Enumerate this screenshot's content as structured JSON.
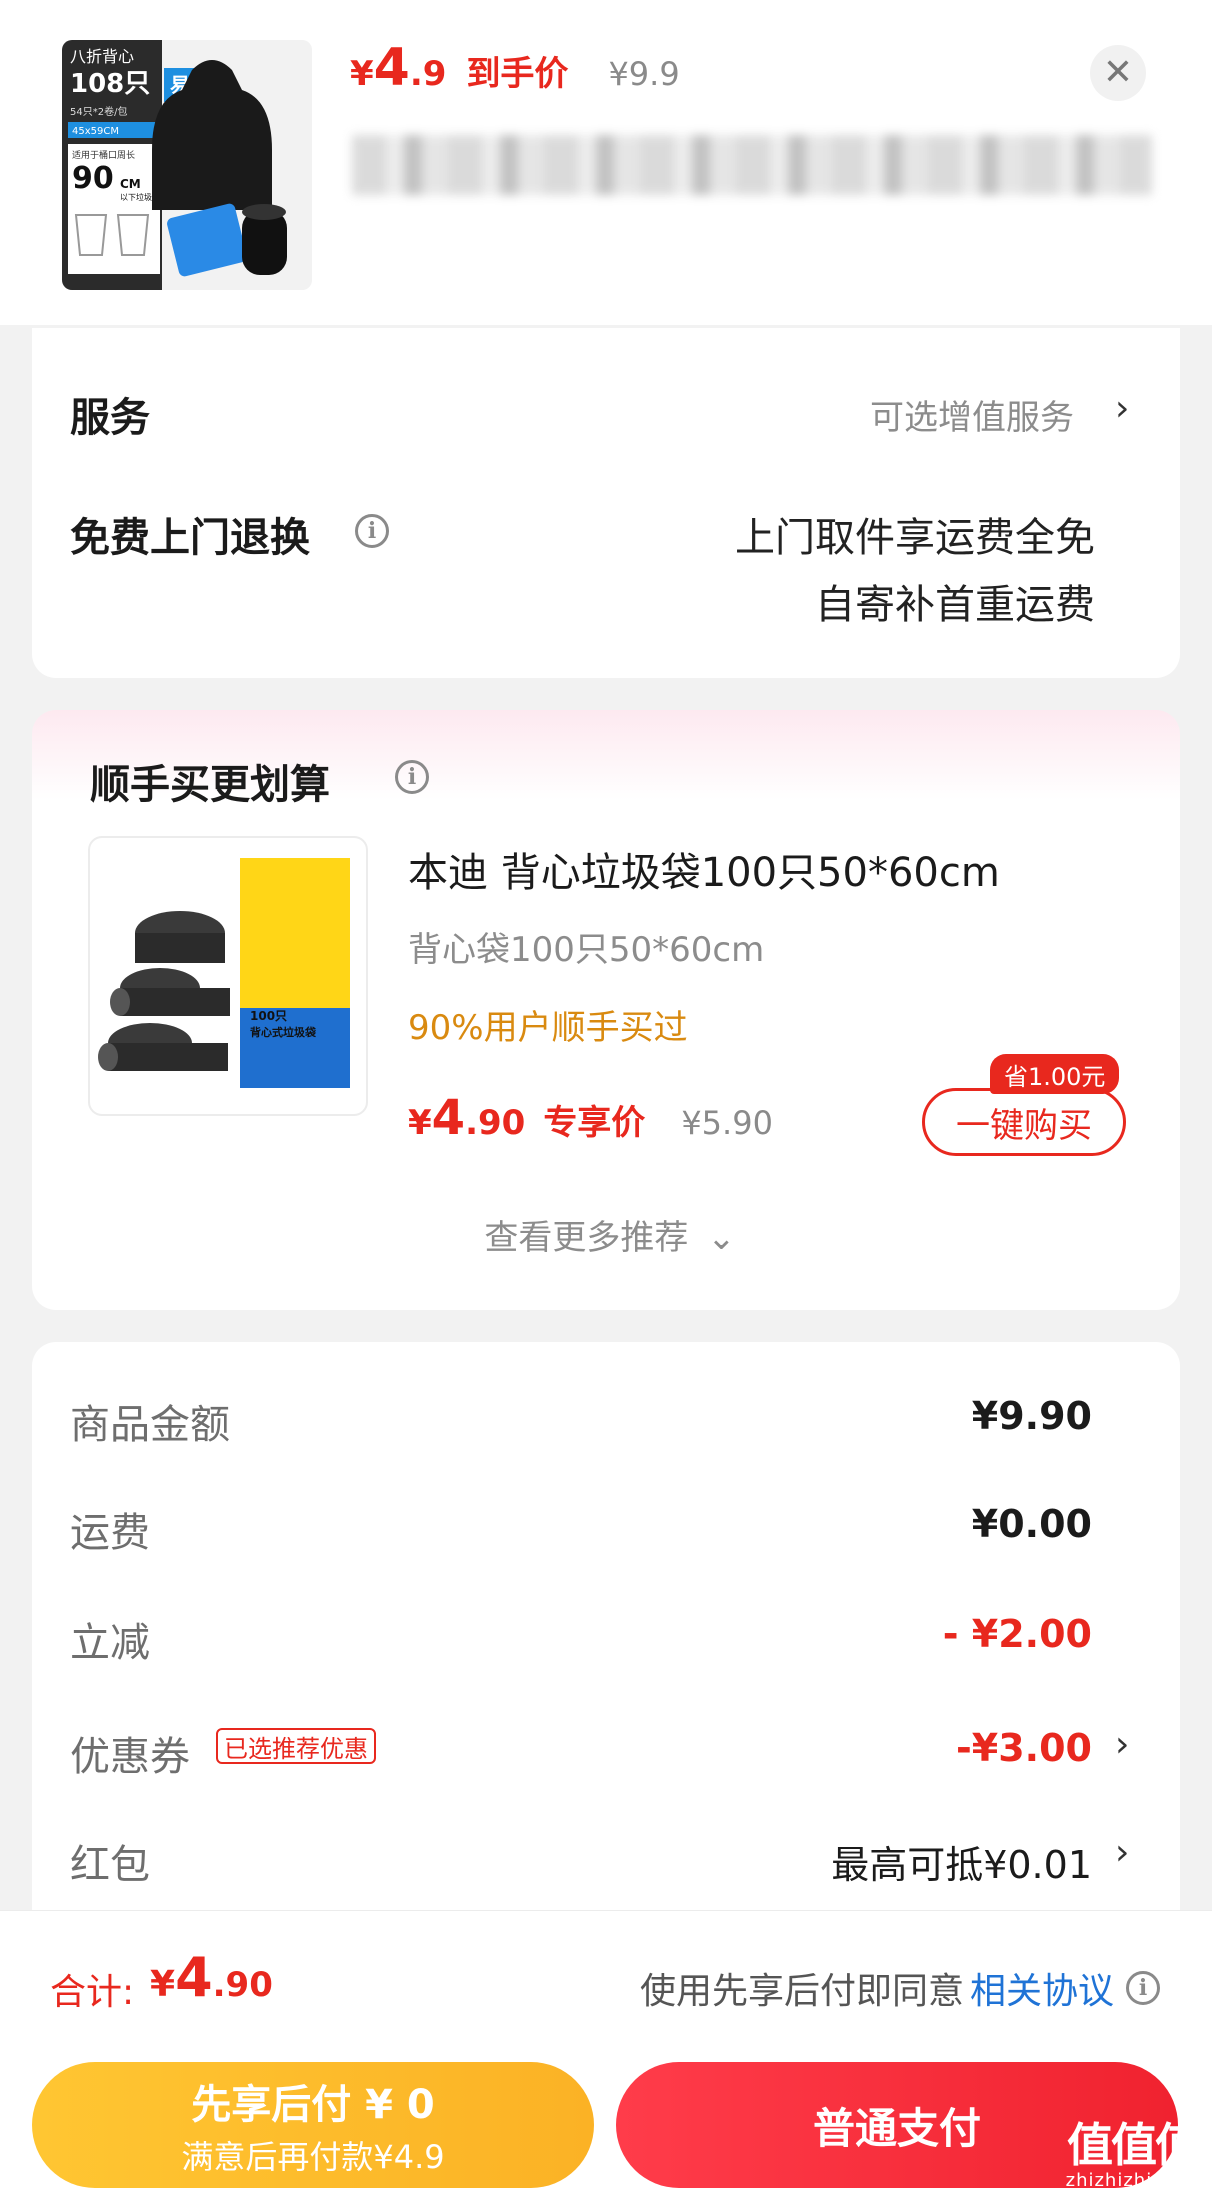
{
  "product": {
    "price_symbol": "¥",
    "price_int": "4",
    "price_dec": ".9",
    "price_tag": "到手价",
    "original_price": "¥9.9",
    "close_icon": "close-icon",
    "thumb_texts": {
      "badge_top": "八折背心",
      "badge_count": "108只",
      "badge_easy": "易撕",
      "spec_line": "54只*2卷/包",
      "size_line": "45x59CM",
      "fit_line": "适用于桶口周长",
      "fit_value": "90",
      "fit_unit": "CM",
      "fit_note": "以下垃圾桶"
    }
  },
  "services": {
    "title": "服务",
    "optional_label": "可选增值服务",
    "return_title": "免费上门退换",
    "return_line1": "上门取件享运费全免",
    "return_line2": "自寄补首重运费"
  },
  "recommend": {
    "title": "顺手买更划算",
    "item_name": "本迪 背心垃圾袋100只50*60cm",
    "item_spec": "背心袋100只50*60cm",
    "item_social": "90%用户顺手买过",
    "price_symbol": "¥",
    "price_int": "4",
    "price_dec": ".90",
    "price_tag": "专享价",
    "original_price": "¥5.90",
    "save_badge": "省1.00元",
    "buy_button": "一键购买",
    "more_label": "查看更多推荐",
    "pack_count": "100只",
    "pack_label": "背心式垃圾袋"
  },
  "summary": {
    "rows": [
      {
        "label": "商品金额",
        "value": "¥9.90"
      },
      {
        "label": "运费",
        "value": "¥0.00"
      },
      {
        "label": "立减",
        "value": "- ¥2.00"
      },
      {
        "label": "优惠券",
        "value": "-¥3.00",
        "tag": "已选推荐优惠"
      },
      {
        "label": "红包",
        "value": "最高可抵¥0.01"
      }
    ]
  },
  "footer": {
    "total_label": "合计:",
    "total_symbol": "¥",
    "total_int": "4",
    "total_dec": ".90",
    "agree_text": "使用先享后付即同意",
    "agree_link": "相关协议",
    "pay_later_main": "先享后付 ¥ 0",
    "pay_later_sub": "满意后再付款¥4.9",
    "pay_normal": "普通支付"
  },
  "watermark": {
    "big": "值值值",
    "small": "zhizhizhi.com"
  },
  "colors": {
    "accent_red": "#e8281e",
    "pay_later_yellow": "#ffc632",
    "link_blue": "#1f73d6",
    "social_orange": "#d98a10"
  }
}
